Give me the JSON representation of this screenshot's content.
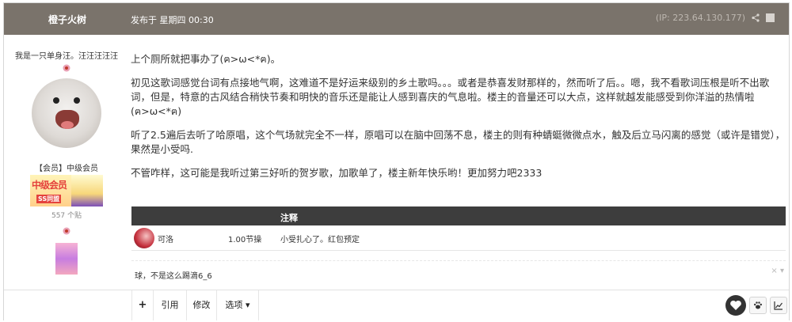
{
  "header": {
    "author": "橙子火树",
    "posted": "发布于 星期四 00:30",
    "ip": "(IP: 223.64.130.177)"
  },
  "sidebar": {
    "signature": "我是一只单身汪。汪汪汪汪汪",
    "rank": "【会员】中级会员",
    "rank_image_title": "中级会员",
    "rank_image_sub": "SS同盟",
    "posts": "557 个贴"
  },
  "content": {
    "paragraphs": [
      "上个厕所就把事办了(ฅ>ω<*ฅ)。",
      "初见这歌词感觉台词有点接地气啊，这难道不是好运来级别的乡土歌吗。。。或者是恭喜发财那样的，然而听了后。。嗯，我不看歌词压根是听不出歌词，但是，特意的古风结合稍快节奏和明快的音乐还是能让人感到喜庆的气息啦。楼主的音量还可以大点，这样就越发能感受到你洋溢的热情啦(ฅ>ω<*ฅ)",
      "听了2.5遍后去听了哈原唱，这个气场就完全不一样，原唱可以在脑中回荡不息，楼主的则有种蜻蜓微微点水，触及后立马闪离的感觉（或许是错觉），果然是小受吗.",
      "不管咋样，这可能是我听过第三好听的贺岁歌，加歌单了，楼主新年快乐哟！更加努力吧2333"
    ]
  },
  "rating": {
    "header": "注释",
    "rows": [
      {
        "user": "可洛",
        "amount": "1.00节操",
        "note": "小受扎心了。红包预定"
      }
    ]
  },
  "signature_line": "球，不是这么踢滴6_6",
  "collapse_label": "× ▾",
  "footer": {
    "plus": "+",
    "quote": "引用",
    "edit": "修改",
    "options": "选项 ▾"
  }
}
